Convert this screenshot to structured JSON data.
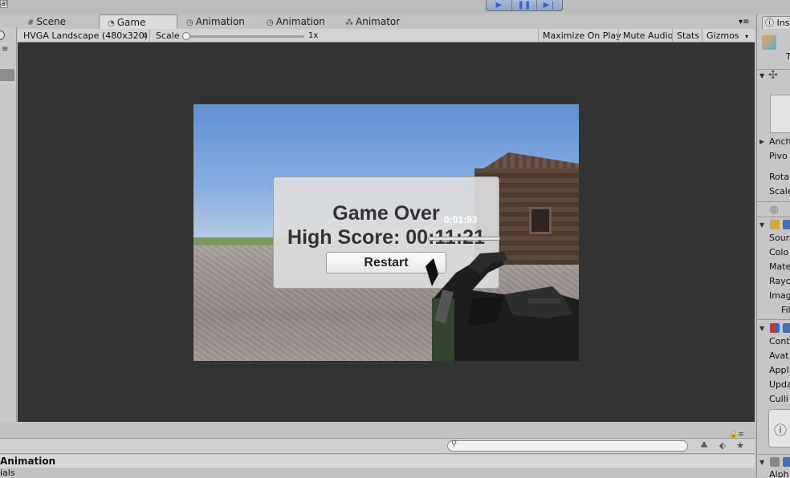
{
  "toolbar": {
    "layers_stub": "al",
    "play_icons": [
      "play-icon",
      "pause-icon",
      "step-icon"
    ]
  },
  "tabs": [
    {
      "label": "Scene",
      "icon": "#"
    },
    {
      "label": "Game",
      "icon": "◔"
    },
    {
      "label": "Animation",
      "icon": "◷"
    },
    {
      "label": "Animation",
      "icon": "◷"
    },
    {
      "label": "Animator",
      "icon": "⁂"
    }
  ],
  "game_toolbar": {
    "aspect": "HVGA Landscape (480x320)",
    "scale_label": "Scale",
    "scale_value": "1x",
    "scale_fraction": 0.0,
    "maximize": "Maximize On Play",
    "mute": "Mute Audio",
    "stats": "Stats",
    "gizmos": "Gizmos"
  },
  "game": {
    "title": "Game Over",
    "score": "High Score: 00:11:21",
    "restart": "Restart",
    "timer": "0:01:93"
  },
  "bottom": {
    "title": "Animation",
    "sub": "ials"
  },
  "inspector": {
    "tab": "Ins",
    "object_letter": "T",
    "rows1": [
      "Anch",
      "Pivo"
    ],
    "rows2": [
      "Rota",
      "Scale"
    ],
    "rows3": [
      "Sour",
      "Colo",
      "Mate",
      "Rayc",
      "Imag",
      "Fil"
    ],
    "rows4": [
      "Cont",
      "Avat",
      "Appl",
      "Upda",
      "Culli"
    ],
    "rows5": [
      "Alph"
    ]
  },
  "colors": {
    "game_background": "#333333",
    "editor_grey": "#c2c2c2",
    "play_blue": "#2f66d6"
  }
}
